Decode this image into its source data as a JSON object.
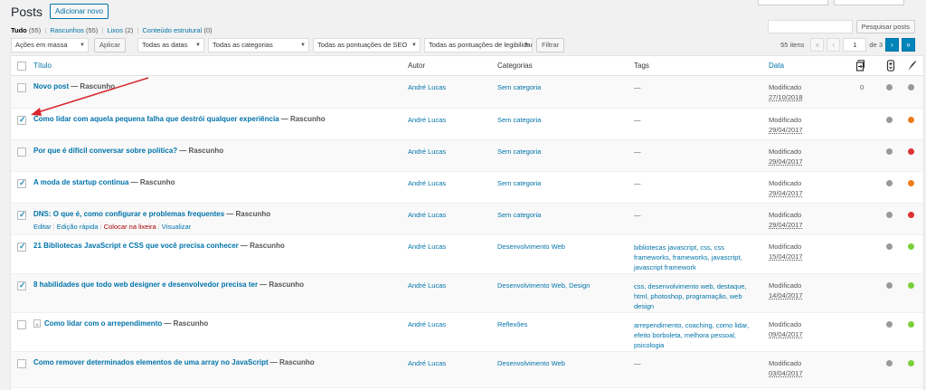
{
  "page": {
    "title": "Posts",
    "add_new": "Adicionar novo"
  },
  "views": [
    {
      "label": "Tudo",
      "count": "(55)",
      "current": true
    },
    {
      "label": "Rascunhos",
      "count": "(55)",
      "current": false
    },
    {
      "label": "Lixos",
      "count": "(2)",
      "current": false
    },
    {
      "label": "Conteúdo estrutural",
      "count": "(0)",
      "current": false
    }
  ],
  "search": {
    "button": "Pesquisar posts",
    "value": ""
  },
  "filters": {
    "bulk_actions": "Ações em massa",
    "apply": "Aplicar",
    "dates": "Todas as datas",
    "categories": "Todas as categorias",
    "seo_scores": "Todas as pontuações de SEO",
    "readability_scores": "Todas as pontuações de legibilidade",
    "filter": "Filtrar"
  },
  "pagination": {
    "items": "55 itens",
    "first": "«",
    "prev": "‹",
    "current_page": "1",
    "of": "de 3",
    "next": "›",
    "last": "»"
  },
  "columns": {
    "title": "Título",
    "author": "Autor",
    "categories": "Categorias",
    "tags": "Tags",
    "date": "Data"
  },
  "colors": {
    "grey": "#999999",
    "orange": "#ee7c1b",
    "red": "#dc3232",
    "green": "#7ad03a",
    "link": "#0073aa"
  },
  "posts": [
    {
      "title": "Novo post",
      "status": "— Rascunho",
      "author": "André Lucas",
      "categories": "Sem categoria",
      "tags": "—",
      "date_label": "Modificado",
      "date": "27/10/2018",
      "links": "0",
      "checked": false,
      "seo": "grey",
      "readability": "grey"
    },
    {
      "title": "Como lidar com aquela pequena falha que destrói qualquer experiência",
      "status": "— Rascunho",
      "author": "André Lucas",
      "categories": "Sem categoria",
      "tags": "—",
      "date_label": "Modificado",
      "date": "29/04/2017",
      "links": "",
      "checked": true,
      "seo": "grey",
      "readability": "orange"
    },
    {
      "title": "Por que é difícil conversar sobre política?",
      "status": "— Rascunho",
      "author": "André Lucas",
      "categories": "Sem categoria",
      "tags": "—",
      "date_label": "Modificado",
      "date": "29/04/2017",
      "links": "",
      "checked": false,
      "seo": "grey",
      "readability": "red"
    },
    {
      "title": "A moda de startup continua",
      "status": "— Rascunho",
      "author": "André Lucas",
      "categories": "Sem categoria",
      "tags": "—",
      "date_label": "Modificado",
      "date": "29/04/2017",
      "links": "",
      "checked": true,
      "seo": "grey",
      "readability": "orange"
    },
    {
      "title": "DNS: O que é, como configurar e problemas frequentes",
      "status": "— Rascunho",
      "author": "André Lucas",
      "categories": "Sem categoria",
      "tags": "—",
      "date_label": "Modificado",
      "date": "29/04/2017",
      "links": "",
      "checked": true,
      "seo": "grey",
      "readability": "red"
    },
    {
      "title": "21 Bibliotecas JavaScript e CSS que você precisa conhecer",
      "status": "— Rascunho",
      "author": "André Lucas",
      "categories": "Desenvolvimento Web",
      "tags": "bibliotecas javascript, css, css frameworks, frameworks, javascript, javascript framework",
      "date_label": "Modificado",
      "date": "15/04/2017",
      "links": "",
      "checked": true,
      "seo": "grey",
      "readability": "green"
    },
    {
      "title": "8 habilidades que todo web designer e desenvolvedor precisa ter",
      "status": "— Rascunho",
      "author": "André Lucas",
      "categories": "Desenvolvimento Web, Design",
      "tags": "css, desenvolvimento web, destaque, html, photoshop, programação, web design",
      "date_label": "Modificado",
      "date": "14/04/2017",
      "links": "",
      "checked": true,
      "seo": "grey",
      "readability": "green"
    },
    {
      "title": "Como lidar com o arrependimento",
      "status": "— Rascunho",
      "author": "André Lucas",
      "categories": "Reflexões",
      "tags": "arrependimento, coaching, como lidar, efeito borboleta, melhora pessoal, psicologia",
      "date_label": "Modificado",
      "date": "09/04/2017",
      "links": "",
      "checked": false,
      "seo": "grey",
      "readability": "green"
    },
    {
      "title": "Como remover determinados elementos de uma array no JavaScript",
      "status": "— Rascunho",
      "author": "André Lucas",
      "categories": "Desenvolvimento Web",
      "tags": "—",
      "date_label": "Modificado",
      "date": "03/04/2017",
      "links": "",
      "checked": false,
      "seo": "grey",
      "readability": "green"
    }
  ],
  "row_actions": {
    "edit": "Editar",
    "quick_edit": "Edição rápida",
    "trash": "Colocar na lixeira",
    "view": "Visualizar"
  }
}
